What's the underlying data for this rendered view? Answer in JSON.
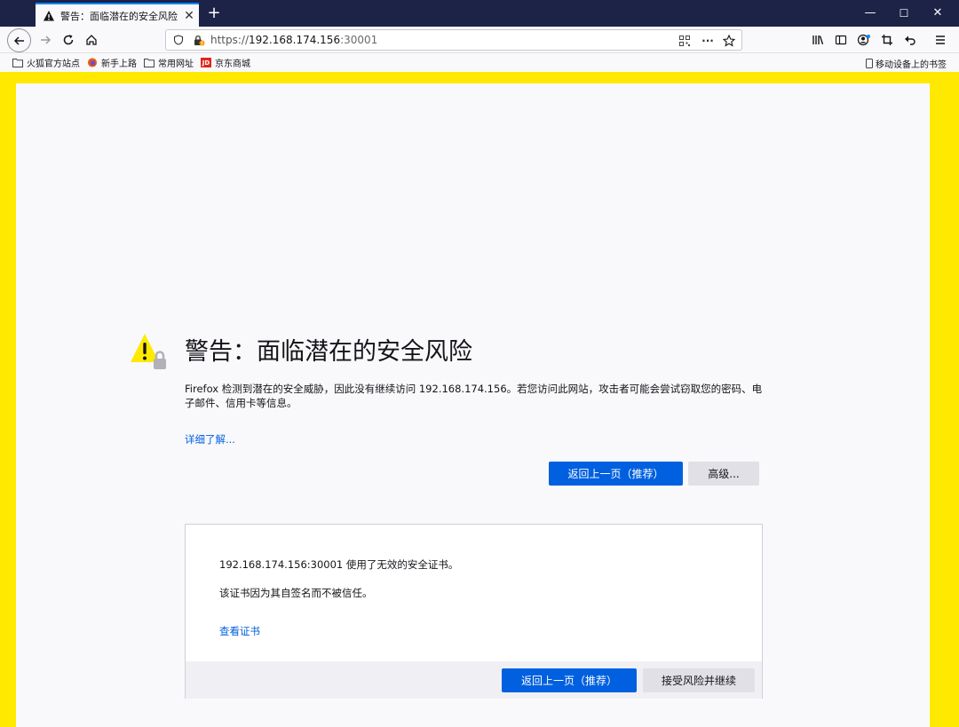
{
  "tab": {
    "title": "警告：面临潜在的安全风险",
    "close": "✕"
  },
  "window": {
    "new_tab": "+",
    "minimize": "—",
    "maximize": "☐",
    "close": "✕"
  },
  "nav": {
    "url_scheme": "https://",
    "url_host": "192.168.174.156",
    "url_port": ":30001",
    "more": "···"
  },
  "bookmarks": {
    "items": [
      "火狐官方站点",
      "新手上路",
      "常用网址",
      "京东商城"
    ],
    "mobile": "移动设备上的书签"
  },
  "error": {
    "title": "警告：面临潜在的安全风险",
    "description": "Firefox 检测到潜在的安全威胁，因此没有继续访问 192.168.174.156。若您访问此网站，攻击者可能会尝试窃取您的密码、电子邮件、信用卡等信息。",
    "learn_more": "详细了解...",
    "go_back": "返回上一页（推荐）",
    "advanced": "高级..."
  },
  "advanced_panel": {
    "line1": "192.168.174.156:30001 使用了无效的安全证书。",
    "line2": "该证书因为其自签名而不被信任。",
    "view_cert": "查看证书",
    "go_back": "返回上一页（推荐）",
    "accept": "接受风险并继续"
  },
  "colors": {
    "accent": "#0060df",
    "warning_border": "#ffe900",
    "titlebar": "#1c2347"
  }
}
